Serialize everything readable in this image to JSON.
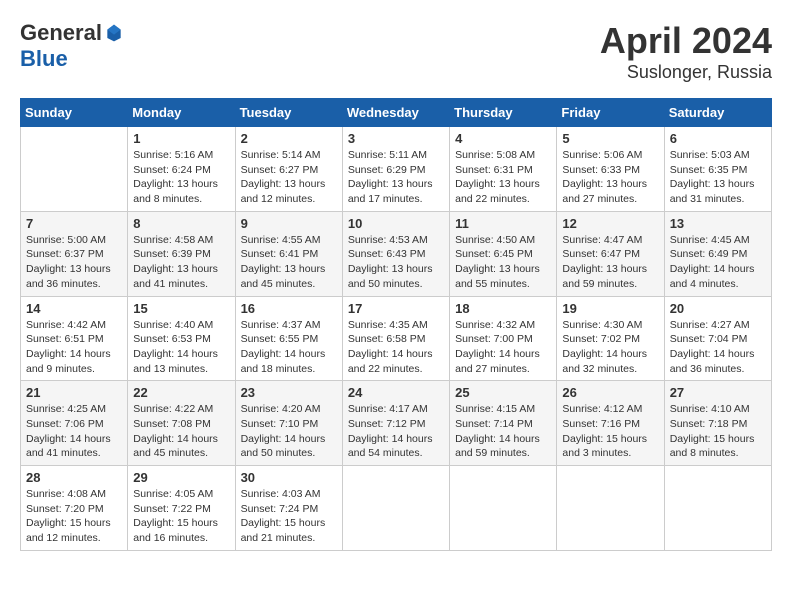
{
  "header": {
    "logo_general": "General",
    "logo_blue": "Blue",
    "month": "April 2024",
    "location": "Suslonger, Russia"
  },
  "weekdays": [
    "Sunday",
    "Monday",
    "Tuesday",
    "Wednesday",
    "Thursday",
    "Friday",
    "Saturday"
  ],
  "weeks": [
    [
      {
        "day": "",
        "info": ""
      },
      {
        "day": "1",
        "info": "Sunrise: 5:16 AM\nSunset: 6:24 PM\nDaylight: 13 hours\nand 8 minutes."
      },
      {
        "day": "2",
        "info": "Sunrise: 5:14 AM\nSunset: 6:27 PM\nDaylight: 13 hours\nand 12 minutes."
      },
      {
        "day": "3",
        "info": "Sunrise: 5:11 AM\nSunset: 6:29 PM\nDaylight: 13 hours\nand 17 minutes."
      },
      {
        "day": "4",
        "info": "Sunrise: 5:08 AM\nSunset: 6:31 PM\nDaylight: 13 hours\nand 22 minutes."
      },
      {
        "day": "5",
        "info": "Sunrise: 5:06 AM\nSunset: 6:33 PM\nDaylight: 13 hours\nand 27 minutes."
      },
      {
        "day": "6",
        "info": "Sunrise: 5:03 AM\nSunset: 6:35 PM\nDaylight: 13 hours\nand 31 minutes."
      }
    ],
    [
      {
        "day": "7",
        "info": "Sunrise: 5:00 AM\nSunset: 6:37 PM\nDaylight: 13 hours\nand 36 minutes."
      },
      {
        "day": "8",
        "info": "Sunrise: 4:58 AM\nSunset: 6:39 PM\nDaylight: 13 hours\nand 41 minutes."
      },
      {
        "day": "9",
        "info": "Sunrise: 4:55 AM\nSunset: 6:41 PM\nDaylight: 13 hours\nand 45 minutes."
      },
      {
        "day": "10",
        "info": "Sunrise: 4:53 AM\nSunset: 6:43 PM\nDaylight: 13 hours\nand 50 minutes."
      },
      {
        "day": "11",
        "info": "Sunrise: 4:50 AM\nSunset: 6:45 PM\nDaylight: 13 hours\nand 55 minutes."
      },
      {
        "day": "12",
        "info": "Sunrise: 4:47 AM\nSunset: 6:47 PM\nDaylight: 13 hours\nand 59 minutes."
      },
      {
        "day": "13",
        "info": "Sunrise: 4:45 AM\nSunset: 6:49 PM\nDaylight: 14 hours\nand 4 minutes."
      }
    ],
    [
      {
        "day": "14",
        "info": "Sunrise: 4:42 AM\nSunset: 6:51 PM\nDaylight: 14 hours\nand 9 minutes."
      },
      {
        "day": "15",
        "info": "Sunrise: 4:40 AM\nSunset: 6:53 PM\nDaylight: 14 hours\nand 13 minutes."
      },
      {
        "day": "16",
        "info": "Sunrise: 4:37 AM\nSunset: 6:55 PM\nDaylight: 14 hours\nand 18 minutes."
      },
      {
        "day": "17",
        "info": "Sunrise: 4:35 AM\nSunset: 6:58 PM\nDaylight: 14 hours\nand 22 minutes."
      },
      {
        "day": "18",
        "info": "Sunrise: 4:32 AM\nSunset: 7:00 PM\nDaylight: 14 hours\nand 27 minutes."
      },
      {
        "day": "19",
        "info": "Sunrise: 4:30 AM\nSunset: 7:02 PM\nDaylight: 14 hours\nand 32 minutes."
      },
      {
        "day": "20",
        "info": "Sunrise: 4:27 AM\nSunset: 7:04 PM\nDaylight: 14 hours\nand 36 minutes."
      }
    ],
    [
      {
        "day": "21",
        "info": "Sunrise: 4:25 AM\nSunset: 7:06 PM\nDaylight: 14 hours\nand 41 minutes."
      },
      {
        "day": "22",
        "info": "Sunrise: 4:22 AM\nSunset: 7:08 PM\nDaylight: 14 hours\nand 45 minutes."
      },
      {
        "day": "23",
        "info": "Sunrise: 4:20 AM\nSunset: 7:10 PM\nDaylight: 14 hours\nand 50 minutes."
      },
      {
        "day": "24",
        "info": "Sunrise: 4:17 AM\nSunset: 7:12 PM\nDaylight: 14 hours\nand 54 minutes."
      },
      {
        "day": "25",
        "info": "Sunrise: 4:15 AM\nSunset: 7:14 PM\nDaylight: 14 hours\nand 59 minutes."
      },
      {
        "day": "26",
        "info": "Sunrise: 4:12 AM\nSunset: 7:16 PM\nDaylight: 15 hours\nand 3 minutes."
      },
      {
        "day": "27",
        "info": "Sunrise: 4:10 AM\nSunset: 7:18 PM\nDaylight: 15 hours\nand 8 minutes."
      }
    ],
    [
      {
        "day": "28",
        "info": "Sunrise: 4:08 AM\nSunset: 7:20 PM\nDaylight: 15 hours\nand 12 minutes."
      },
      {
        "day": "29",
        "info": "Sunrise: 4:05 AM\nSunset: 7:22 PM\nDaylight: 15 hours\nand 16 minutes."
      },
      {
        "day": "30",
        "info": "Sunrise: 4:03 AM\nSunset: 7:24 PM\nDaylight: 15 hours\nand 21 minutes."
      },
      {
        "day": "",
        "info": ""
      },
      {
        "day": "",
        "info": ""
      },
      {
        "day": "",
        "info": ""
      },
      {
        "day": "",
        "info": ""
      }
    ]
  ]
}
